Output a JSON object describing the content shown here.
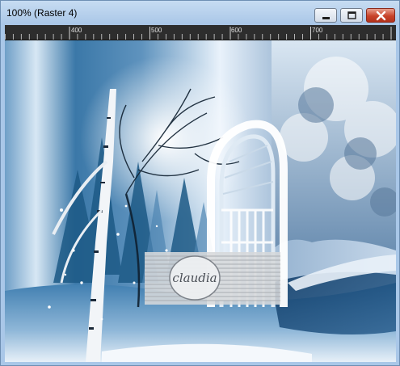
{
  "window": {
    "title": "100% (Raster 4)",
    "controls": {
      "minimize_icon": "minimize-icon",
      "maximize_icon": "maximize-icon",
      "close_icon": "close-icon"
    }
  },
  "ruler": {
    "labels": [
      "400",
      "500",
      "600",
      "700"
    ]
  },
  "canvas": {
    "watermark_text": "claudia",
    "colors": {
      "sky": "#e9f2fb",
      "deep_blue": "#1f5f8c",
      "mid_blue": "#5f93be",
      "snow": "#f4f8fc",
      "watermark": "#c9ccd0"
    }
  }
}
